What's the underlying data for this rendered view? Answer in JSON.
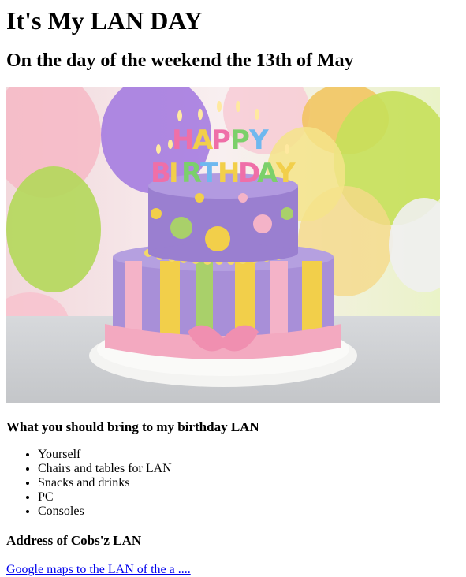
{
  "page": {
    "title": "It's My LAN DAY",
    "subtitle": "On the day of the weekend the 13th of May",
    "image_alt": "Happy Birthday cake",
    "image_caption": "HAPPY BIRTHDAY",
    "bring_heading": "What you should bring to my birthday LAN",
    "bring_items": [
      "Yourself",
      "Chairs and tables for LAN",
      "Snacks and drinks",
      "PC",
      "Consoles"
    ],
    "address_heading": "Address of Cobs'z LAN",
    "map_link": "Google maps to the LAN of the a ...."
  },
  "colors": {
    "link": "#0000ee",
    "cake_purple": "#9a7fd0",
    "cake_pink": "#f4b3c8",
    "cake_yellow": "#f2cf4a",
    "cake_green": "#a9d06a"
  }
}
